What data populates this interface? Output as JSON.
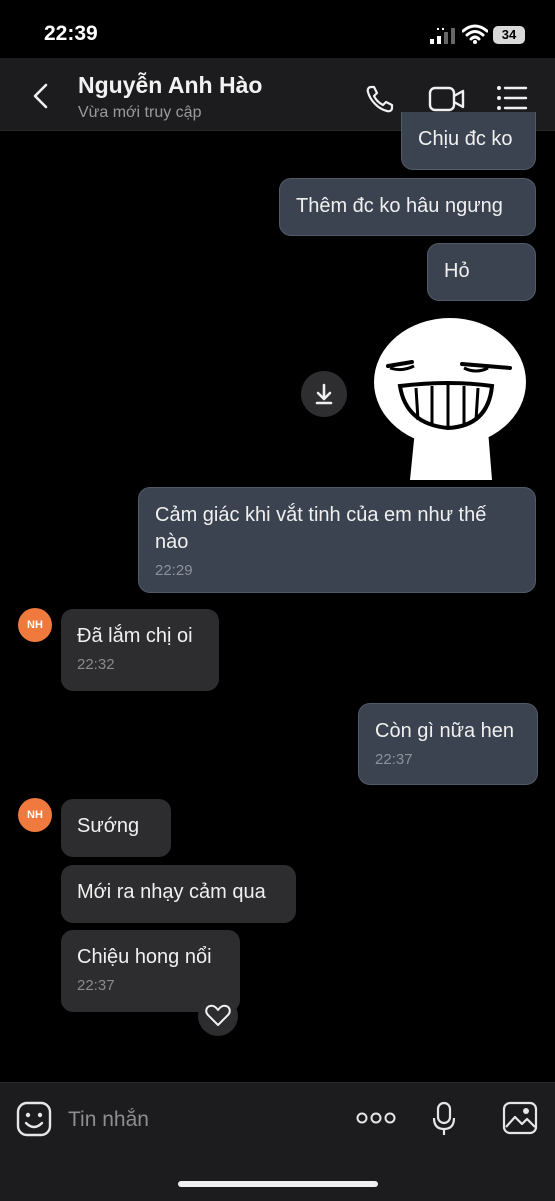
{
  "status_bar": {
    "time": "22:39",
    "battery": "34"
  },
  "header": {
    "contact_name": "Nguyễn Anh Hào",
    "contact_status": "Vừa mới truy cập"
  },
  "avatar_initials": "NH",
  "messages": [
    {
      "direction": "outgoing",
      "text": "Chịu đc ko"
    },
    {
      "direction": "outgoing",
      "text": "Thêm đc ko hâu ngưng"
    },
    {
      "direction": "outgoing",
      "text": "Hỏ"
    },
    {
      "direction": "outgoing",
      "type": "sticker",
      "icon": "grinning-face-sticker"
    },
    {
      "direction": "outgoing",
      "text": "Cảm giác khi vắt tinh của em như thế nào",
      "time": "22:29"
    },
    {
      "direction": "incoming",
      "text": "Đã lắm chị oi",
      "time": "22:32"
    },
    {
      "direction": "outgoing",
      "text": "Còn gì nữa hen",
      "time": "22:37"
    },
    {
      "direction": "incoming",
      "text": "Sướng"
    },
    {
      "direction": "incoming",
      "text": "Mới ra nhạy cảm qua"
    },
    {
      "direction": "incoming",
      "text": "Chiệu hong nổi",
      "time": "22:37"
    }
  ],
  "composer": {
    "placeholder": "Tin nhắn"
  },
  "colors": {
    "background": "#000000",
    "outgoing_bubble": "#3b4350",
    "incoming_bubble": "#2d2d2f",
    "avatar": "#f07a3e",
    "bar": "#1c1c1e"
  }
}
